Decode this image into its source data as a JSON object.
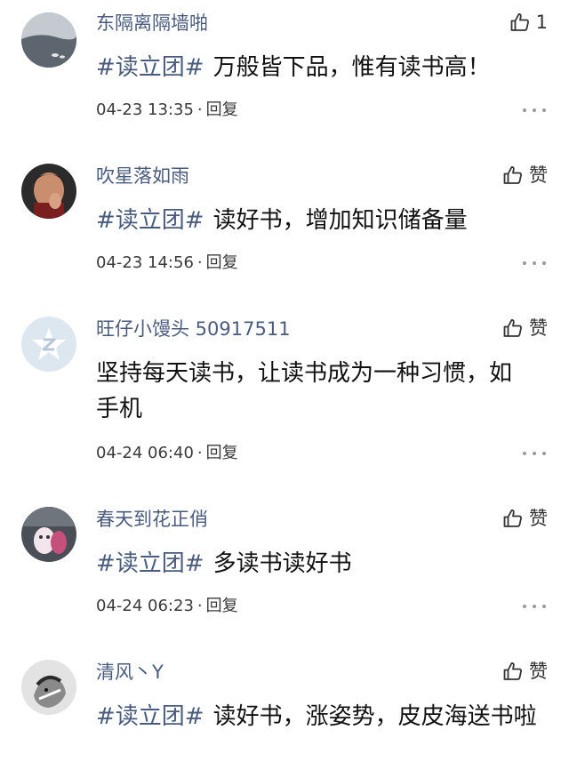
{
  "comments": [
    {
      "username": "东隔离隔墙啪",
      "like_label": "1",
      "topic": "#读立团#",
      "text": "万般皆下品，惟有读书高！",
      "time": "04-23 13:35",
      "separator": "·",
      "reply_label": "回复"
    },
    {
      "username": "吹星落如雨",
      "like_label": "赞",
      "topic": "#读立团#",
      "text": "读好书，增加知识储备量",
      "time": "04-23 14:56",
      "separator": "·",
      "reply_label": "回复"
    },
    {
      "username": "旺仔小馒头 50917511",
      "like_label": "赞",
      "topic": "",
      "text": "坚持每天读书，让读书成为一种习惯，如手机",
      "time": "04-24 06:40",
      "separator": "·",
      "reply_label": "回复"
    },
    {
      "username": "春天到花正俏",
      "like_label": "赞",
      "topic": "#读立团#",
      "text": "多读书读好书",
      "time": "04-24 06:23",
      "separator": "·",
      "reply_label": "回复"
    },
    {
      "username": "清风丶Y",
      "like_label": "赞",
      "topic": "#读立团#",
      "text": "读好书，涨姿势，皮皮海送书啦",
      "time": "",
      "separator": "",
      "reply_label": ""
    }
  ],
  "colors": {
    "username": "#4a5c7e",
    "topic": "#4a5c7e",
    "body_text": "#111111",
    "meta_text": "#3a3a3a",
    "more_dots": "#9a9a9a",
    "background": "#ffffff"
  },
  "icons": {
    "like": "thumbs-up-icon",
    "more": "more-options-icon"
  }
}
